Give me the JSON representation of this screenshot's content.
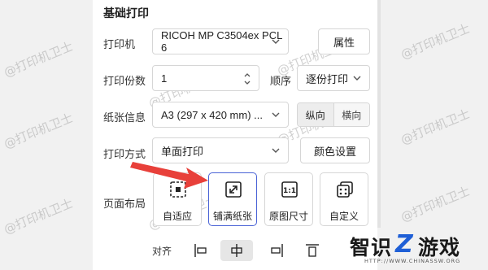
{
  "section": {
    "title": "基础打印"
  },
  "printer": {
    "label": "打印机",
    "value": "RICOH MP C3504ex PCL 6",
    "properties_button": "属性"
  },
  "copies": {
    "label": "打印份数",
    "value": "1",
    "order_label": "顺序",
    "order_value": "逐份打印"
  },
  "paper": {
    "label": "纸张信息",
    "value": "A3 (297 x 420 mm) ...",
    "portrait": "纵向",
    "landscape": "横向",
    "selected_orientation": "纵向"
  },
  "mode": {
    "label": "打印方式",
    "value": "单面打印",
    "color_button": "颜色设置"
  },
  "layout": {
    "label": "页面布局",
    "options": [
      {
        "label": "自适应",
        "icon": "fit-icon",
        "selected": false
      },
      {
        "label": "铺满纸张",
        "icon": "expand-diagonal-icon",
        "selected": true
      },
      {
        "label": "原图尺寸",
        "icon": "one-to-one-icon",
        "selected": false
      },
      {
        "label": "自定义",
        "icon": "custom-layers-icon",
        "selected": false
      }
    ]
  },
  "alignment": {
    "label": "对齐",
    "options": [
      {
        "name": "align-left",
        "selected": false
      },
      {
        "name": "align-center",
        "selected": true
      },
      {
        "name": "align-right",
        "selected": false
      },
      {
        "name": "align-top",
        "selected": false
      }
    ]
  },
  "watermark": {
    "text": "@打印机卫士"
  },
  "logo": {
    "text_left": "智识",
    "text_right": "游戏",
    "url": "HTTP://WWW.CHINASSW.ORG"
  },
  "colors": {
    "accent": "#4a63d6",
    "arrow": "#e8403a",
    "logo_blue": "#1f5fd6"
  }
}
